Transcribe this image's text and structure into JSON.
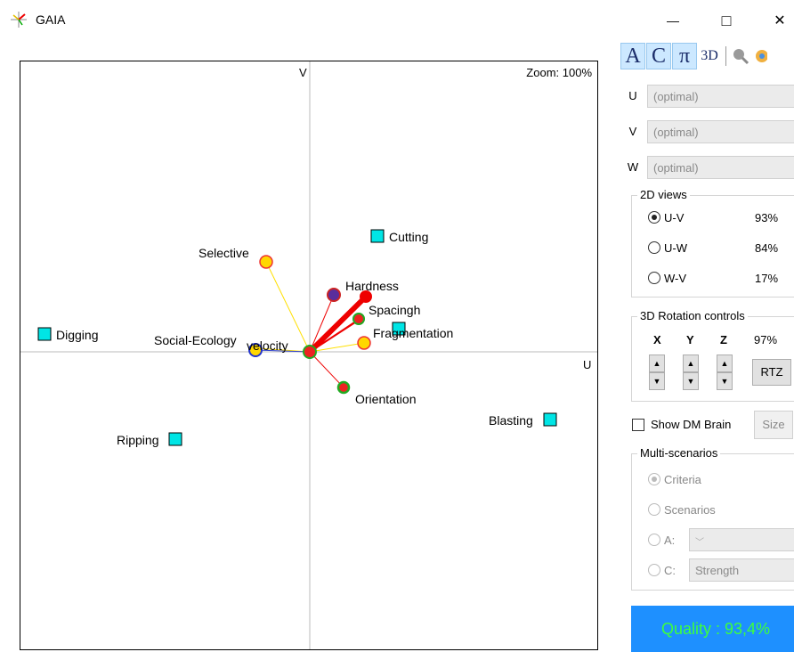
{
  "window": {
    "title": "GAIA",
    "minimize_glyph": "—",
    "maximize_glyph": "□",
    "close_glyph": "✕"
  },
  "plot": {
    "zoom_label": "Zoom: 100%",
    "axis_v_label": "V",
    "axis_u_label": "U",
    "criteria": [
      {
        "label": "Selective",
        "color": "#ffd700"
      },
      {
        "label": "Hardness",
        "color": "#5a2d9c"
      },
      {
        "label": "Spacingh",
        "color": "#22aa22"
      },
      {
        "label": "Fragmentation",
        "color": "#ffd700"
      },
      {
        "label": "Social-Ecology",
        "color": "#ffd700"
      },
      {
        "label": "velocity",
        "color": "#3344cc"
      },
      {
        "label": "Orientation",
        "color": "#22aa22"
      }
    ],
    "alternatives": [
      {
        "label": "Cutting"
      },
      {
        "label": "Digging"
      },
      {
        "label": "Blasting"
      },
      {
        "label": "Ripping"
      }
    ],
    "decision_stick_color": "#ee0000",
    "alternative_color": "#00e5e5"
  },
  "toolbar": {
    "buttons": [
      {
        "label": "A",
        "active": true
      },
      {
        "label": "C",
        "active": true
      },
      {
        "label": "π",
        "active": true
      },
      {
        "label": "3D",
        "active": false
      }
    ],
    "search_icon": "search-icon",
    "settings_icon": "gear-icon"
  },
  "axes": [
    {
      "label": "U",
      "value": "(optimal)"
    },
    {
      "label": "V",
      "value": "(optimal)"
    },
    {
      "label": "W",
      "value": "(optimal)"
    }
  ],
  "views_2d": {
    "title": "2D views",
    "options": [
      {
        "label": "U-V",
        "percent": "93%",
        "selected": true
      },
      {
        "label": "U-W",
        "percent": "84%",
        "selected": false
      },
      {
        "label": "W-V",
        "percent": "17%",
        "selected": false
      }
    ]
  },
  "rotation": {
    "title": "3D Rotation controls",
    "x_label": "X",
    "y_label": "Y",
    "z_label": "Z",
    "percent": "97%",
    "rtz_label": "RTZ"
  },
  "dm_brain": {
    "label": "Show DM Brain",
    "checked": false,
    "size_label": "Size"
  },
  "multi_scenarios": {
    "title": "Multi-scenarios",
    "options": [
      {
        "label": "Criteria",
        "selected": true
      },
      {
        "label": "Scenarios",
        "selected": false
      }
    ],
    "a_label": "A:",
    "a_value": "",
    "c_label": "C:",
    "c_value": "Strength"
  },
  "quality": {
    "label": "Quality : 93,4%"
  }
}
